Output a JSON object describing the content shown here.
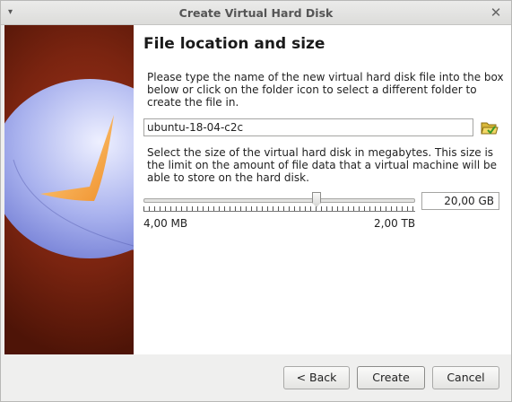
{
  "window": {
    "title": "Create Virtual Hard Disk",
    "menu_glyph": "▾",
    "close_glyph": "✕"
  },
  "main": {
    "heading": "File location and size",
    "location_instructions": "Please type the name of the new virtual hard disk file into the box below or click on the folder icon to select a different folder to create the file in.",
    "file_name": "ubuntu-18-04-c2c",
    "size_instructions": "Select the size of the virtual hard disk in megabytes. This size is the limit on the amount of file data that a virtual machine will be able to store on the hard disk.",
    "size_value": "20,00 GB",
    "slider_min_label": "4,00 MB",
    "slider_max_label": "2,00 TB",
    "slider_fraction": 0.64
  },
  "buttons": {
    "back": "< Back",
    "create": "Create",
    "cancel": "Cancel"
  },
  "icons": {
    "sidebar": "hard-disk-pie-illustration",
    "folder": "folder-open-icon"
  },
  "colors": {
    "sidebar_red": "#7a2410",
    "disk_blue": "#8a94e0",
    "disk_orange": "#f0a050",
    "folder_yellow": "#e8c84a",
    "folder_arrow": "#3a9a2a"
  }
}
